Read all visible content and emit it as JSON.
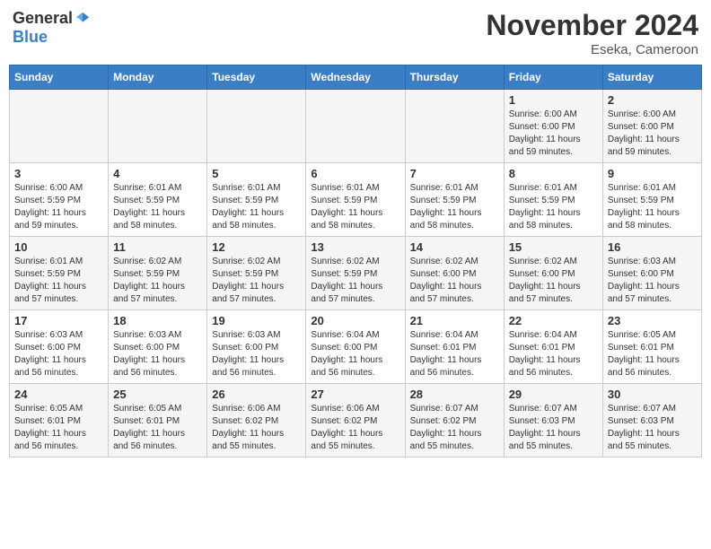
{
  "header": {
    "logo_general": "General",
    "logo_blue": "Blue",
    "month_title": "November 2024",
    "location": "Eseka, Cameroon"
  },
  "days_of_week": [
    "Sunday",
    "Monday",
    "Tuesday",
    "Wednesday",
    "Thursday",
    "Friday",
    "Saturday"
  ],
  "weeks": [
    [
      {
        "day": "",
        "info": ""
      },
      {
        "day": "",
        "info": ""
      },
      {
        "day": "",
        "info": ""
      },
      {
        "day": "",
        "info": ""
      },
      {
        "day": "",
        "info": ""
      },
      {
        "day": "1",
        "info": "Sunrise: 6:00 AM\nSunset: 6:00 PM\nDaylight: 11 hours\nand 59 minutes."
      },
      {
        "day": "2",
        "info": "Sunrise: 6:00 AM\nSunset: 6:00 PM\nDaylight: 11 hours\nand 59 minutes."
      }
    ],
    [
      {
        "day": "3",
        "info": "Sunrise: 6:00 AM\nSunset: 5:59 PM\nDaylight: 11 hours\nand 59 minutes."
      },
      {
        "day": "4",
        "info": "Sunrise: 6:01 AM\nSunset: 5:59 PM\nDaylight: 11 hours\nand 58 minutes."
      },
      {
        "day": "5",
        "info": "Sunrise: 6:01 AM\nSunset: 5:59 PM\nDaylight: 11 hours\nand 58 minutes."
      },
      {
        "day": "6",
        "info": "Sunrise: 6:01 AM\nSunset: 5:59 PM\nDaylight: 11 hours\nand 58 minutes."
      },
      {
        "day": "7",
        "info": "Sunrise: 6:01 AM\nSunset: 5:59 PM\nDaylight: 11 hours\nand 58 minutes."
      },
      {
        "day": "8",
        "info": "Sunrise: 6:01 AM\nSunset: 5:59 PM\nDaylight: 11 hours\nand 58 minutes."
      },
      {
        "day": "9",
        "info": "Sunrise: 6:01 AM\nSunset: 5:59 PM\nDaylight: 11 hours\nand 58 minutes."
      }
    ],
    [
      {
        "day": "10",
        "info": "Sunrise: 6:01 AM\nSunset: 5:59 PM\nDaylight: 11 hours\nand 57 minutes."
      },
      {
        "day": "11",
        "info": "Sunrise: 6:02 AM\nSunset: 5:59 PM\nDaylight: 11 hours\nand 57 minutes."
      },
      {
        "day": "12",
        "info": "Sunrise: 6:02 AM\nSunset: 5:59 PM\nDaylight: 11 hours\nand 57 minutes."
      },
      {
        "day": "13",
        "info": "Sunrise: 6:02 AM\nSunset: 5:59 PM\nDaylight: 11 hours\nand 57 minutes."
      },
      {
        "day": "14",
        "info": "Sunrise: 6:02 AM\nSunset: 6:00 PM\nDaylight: 11 hours\nand 57 minutes."
      },
      {
        "day": "15",
        "info": "Sunrise: 6:02 AM\nSunset: 6:00 PM\nDaylight: 11 hours\nand 57 minutes."
      },
      {
        "day": "16",
        "info": "Sunrise: 6:03 AM\nSunset: 6:00 PM\nDaylight: 11 hours\nand 57 minutes."
      }
    ],
    [
      {
        "day": "17",
        "info": "Sunrise: 6:03 AM\nSunset: 6:00 PM\nDaylight: 11 hours\nand 56 minutes."
      },
      {
        "day": "18",
        "info": "Sunrise: 6:03 AM\nSunset: 6:00 PM\nDaylight: 11 hours\nand 56 minutes."
      },
      {
        "day": "19",
        "info": "Sunrise: 6:03 AM\nSunset: 6:00 PM\nDaylight: 11 hours\nand 56 minutes."
      },
      {
        "day": "20",
        "info": "Sunrise: 6:04 AM\nSunset: 6:00 PM\nDaylight: 11 hours\nand 56 minutes."
      },
      {
        "day": "21",
        "info": "Sunrise: 6:04 AM\nSunset: 6:01 PM\nDaylight: 11 hours\nand 56 minutes."
      },
      {
        "day": "22",
        "info": "Sunrise: 6:04 AM\nSunset: 6:01 PM\nDaylight: 11 hours\nand 56 minutes."
      },
      {
        "day": "23",
        "info": "Sunrise: 6:05 AM\nSunset: 6:01 PM\nDaylight: 11 hours\nand 56 minutes."
      }
    ],
    [
      {
        "day": "24",
        "info": "Sunrise: 6:05 AM\nSunset: 6:01 PM\nDaylight: 11 hours\nand 56 minutes."
      },
      {
        "day": "25",
        "info": "Sunrise: 6:05 AM\nSunset: 6:01 PM\nDaylight: 11 hours\nand 56 minutes."
      },
      {
        "day": "26",
        "info": "Sunrise: 6:06 AM\nSunset: 6:02 PM\nDaylight: 11 hours\nand 55 minutes."
      },
      {
        "day": "27",
        "info": "Sunrise: 6:06 AM\nSunset: 6:02 PM\nDaylight: 11 hours\nand 55 minutes."
      },
      {
        "day": "28",
        "info": "Sunrise: 6:07 AM\nSunset: 6:02 PM\nDaylight: 11 hours\nand 55 minutes."
      },
      {
        "day": "29",
        "info": "Sunrise: 6:07 AM\nSunset: 6:03 PM\nDaylight: 11 hours\nand 55 minutes."
      },
      {
        "day": "30",
        "info": "Sunrise: 6:07 AM\nSunset: 6:03 PM\nDaylight: 11 hours\nand 55 minutes."
      }
    ]
  ]
}
